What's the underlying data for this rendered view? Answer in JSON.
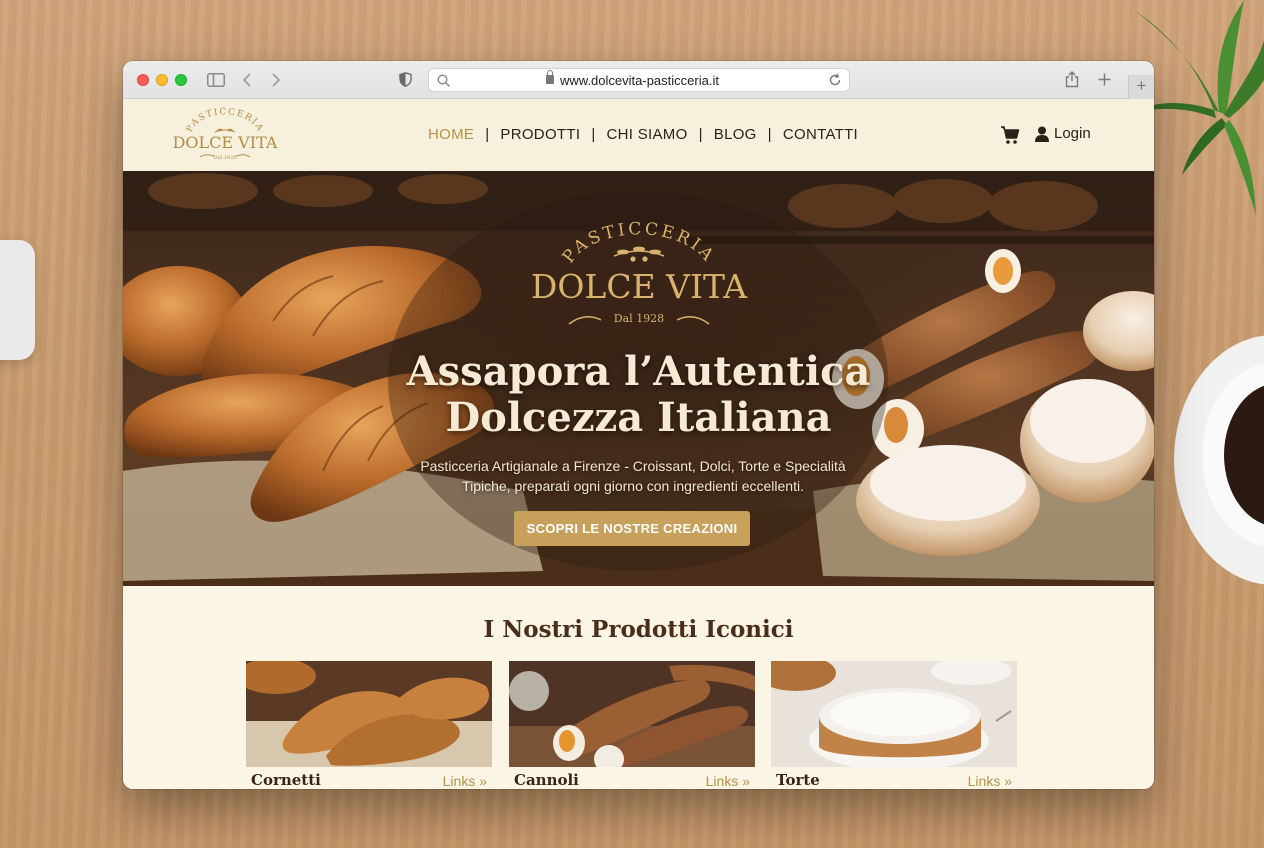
{
  "browser": {
    "url": "www.dolcevita-pasticceria.it"
  },
  "site": {
    "logo": {
      "top": "PASTICCERIA",
      "name": "DOLCE VITA",
      "tag": "Dal 1928"
    },
    "nav": {
      "items": [
        "HOME",
        "PRODOTTI",
        "CHI SIAMO",
        "BLOG",
        "CONTATTI"
      ],
      "active": "HOME",
      "login": "Login"
    },
    "hero": {
      "emblem_top": "PASTICCERIA",
      "emblem_name": "DOLCE VITA",
      "emblem_tag": "Dal 1928",
      "title_line1": "Assapora l’Autentica",
      "title_line2": "Dolcezza Italiana",
      "subtitle_line1": "Pasticceria Artigianale a Firenze - Croissant, Dolci, Torte e Specialità",
      "subtitle_line2": "Tipiche, preparati ogni giorno con ingredienti eccellenti.",
      "cta": "SCOPRI LE NOSTRE CREAZIONI"
    },
    "products": {
      "title": "I Nostri Prodotti Iconici",
      "items": [
        {
          "name": "Cornetti",
          "link": "Links »"
        },
        {
          "name": "Cannoli",
          "link": "Links »"
        },
        {
          "name": "Torte",
          "link": "Links »"
        }
      ]
    }
  },
  "colors": {
    "accent": "#c7a05b",
    "header_bg": "#f7f0dd",
    "text_dark": "#2b2118",
    "title_brown": "#4a2e1a"
  },
  "icons": [
    "sidebar-icon",
    "back-icon",
    "forward-icon",
    "shield-icon",
    "search-icon",
    "lock-icon",
    "reload-icon",
    "share-icon",
    "new-tab-icon",
    "cart-icon",
    "user-icon"
  ]
}
